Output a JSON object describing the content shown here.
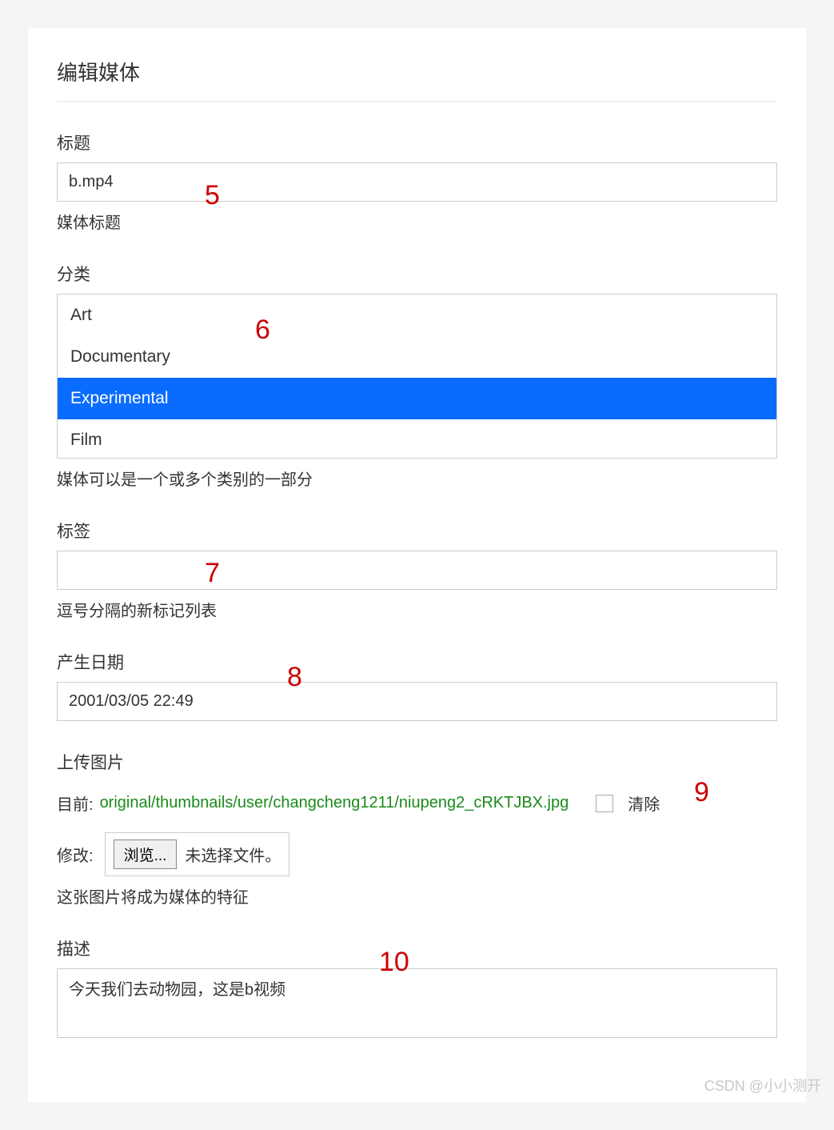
{
  "header": {
    "title": "编辑媒体"
  },
  "title_field": {
    "label": "标题",
    "value": "b.mp4",
    "help": "媒体标题"
  },
  "category_field": {
    "label": "分类",
    "options": [
      {
        "label": "Art",
        "selected": false
      },
      {
        "label": "Documentary",
        "selected": false
      },
      {
        "label": "Experimental",
        "selected": true
      },
      {
        "label": "Film",
        "selected": false
      }
    ],
    "help": "媒体可以是一个或多个类别的一部分"
  },
  "tags_field": {
    "label": "标签",
    "value": "",
    "help": "逗号分隔的新标记列表"
  },
  "date_field": {
    "label": "产生日期",
    "value": "2001/03/05 22:49"
  },
  "upload_field": {
    "label": "上传图片",
    "current_label": "目前:",
    "current_path": "original/thumbnails/user/changcheng1211/niupeng2_cRKTJBX.jpg",
    "clear_label": "清除",
    "modify_label": "修改:",
    "browse_label": "浏览...",
    "no_file_label": "未选择文件。",
    "help": "这张图片将成为媒体的特征"
  },
  "description_field": {
    "label": "描述",
    "value": "今天我们去动物园，这是b视频"
  },
  "annotations": {
    "a5": "5",
    "a6": "6",
    "a7": "7",
    "a8": "8",
    "a9": "9",
    "a10": "10"
  },
  "watermark": "CSDN @小小测开"
}
